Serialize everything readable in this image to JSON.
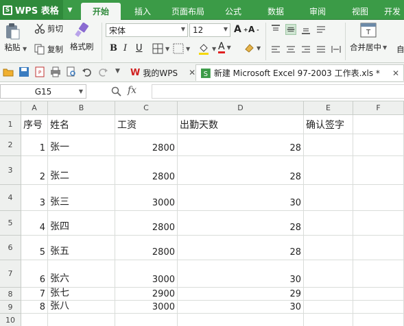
{
  "app": {
    "title": "WPS 表格",
    "logo": "S"
  },
  "menu_tabs": [
    {
      "label": "开始",
      "active": true
    },
    {
      "label": "插入"
    },
    {
      "label": "页面布局"
    },
    {
      "label": "公式"
    },
    {
      "label": "数据"
    },
    {
      "label": "审阅"
    },
    {
      "label": "视图"
    },
    {
      "label": "开发"
    }
  ],
  "ribbon": {
    "paste_label": "粘贴",
    "cut_label": "剪切",
    "copy_label": "复制",
    "format_painter_label": "格式刷",
    "font_name": "宋体",
    "font_size": "12",
    "merge_center_label": "合并居中"
  },
  "doc_tabs": {
    "home_label": "我的WPS",
    "file_label": "新建 Microsoft Excel 97-2003 工作表.xls *"
  },
  "formula_bar": {
    "cell_ref": "G15",
    "fx_label": "fx",
    "formula": ""
  },
  "sheet": {
    "columns": [
      "A",
      "B",
      "C",
      "D",
      "E",
      "F"
    ],
    "row_numbers": [
      "1",
      "2",
      "3",
      "4",
      "5",
      "6",
      "7",
      "8",
      "9",
      "10"
    ],
    "header": [
      "序号",
      "姓名",
      "工资",
      "出勤天数",
      "确认签字",
      ""
    ],
    "rows": [
      [
        "1",
        "张一",
        "2800",
        "28",
        "",
        ""
      ],
      [
        "2",
        "张二",
        "2800",
        "28",
        "",
        ""
      ],
      [
        "3",
        "张三",
        "3000",
        "30",
        "",
        ""
      ],
      [
        "4",
        "张四",
        "2800",
        "28",
        "",
        ""
      ],
      [
        "5",
        "张五",
        "2800",
        "28",
        "",
        ""
      ],
      [
        "6",
        "张六",
        "3000",
        "30",
        "",
        ""
      ],
      [
        "7",
        "张七",
        "2900",
        "29",
        "",
        ""
      ],
      [
        "8",
        "张八",
        "3000",
        "30",
        "",
        ""
      ]
    ]
  },
  "colors": {
    "accent": "#3b9b47",
    "accent_dark": "#2f8a3b"
  }
}
